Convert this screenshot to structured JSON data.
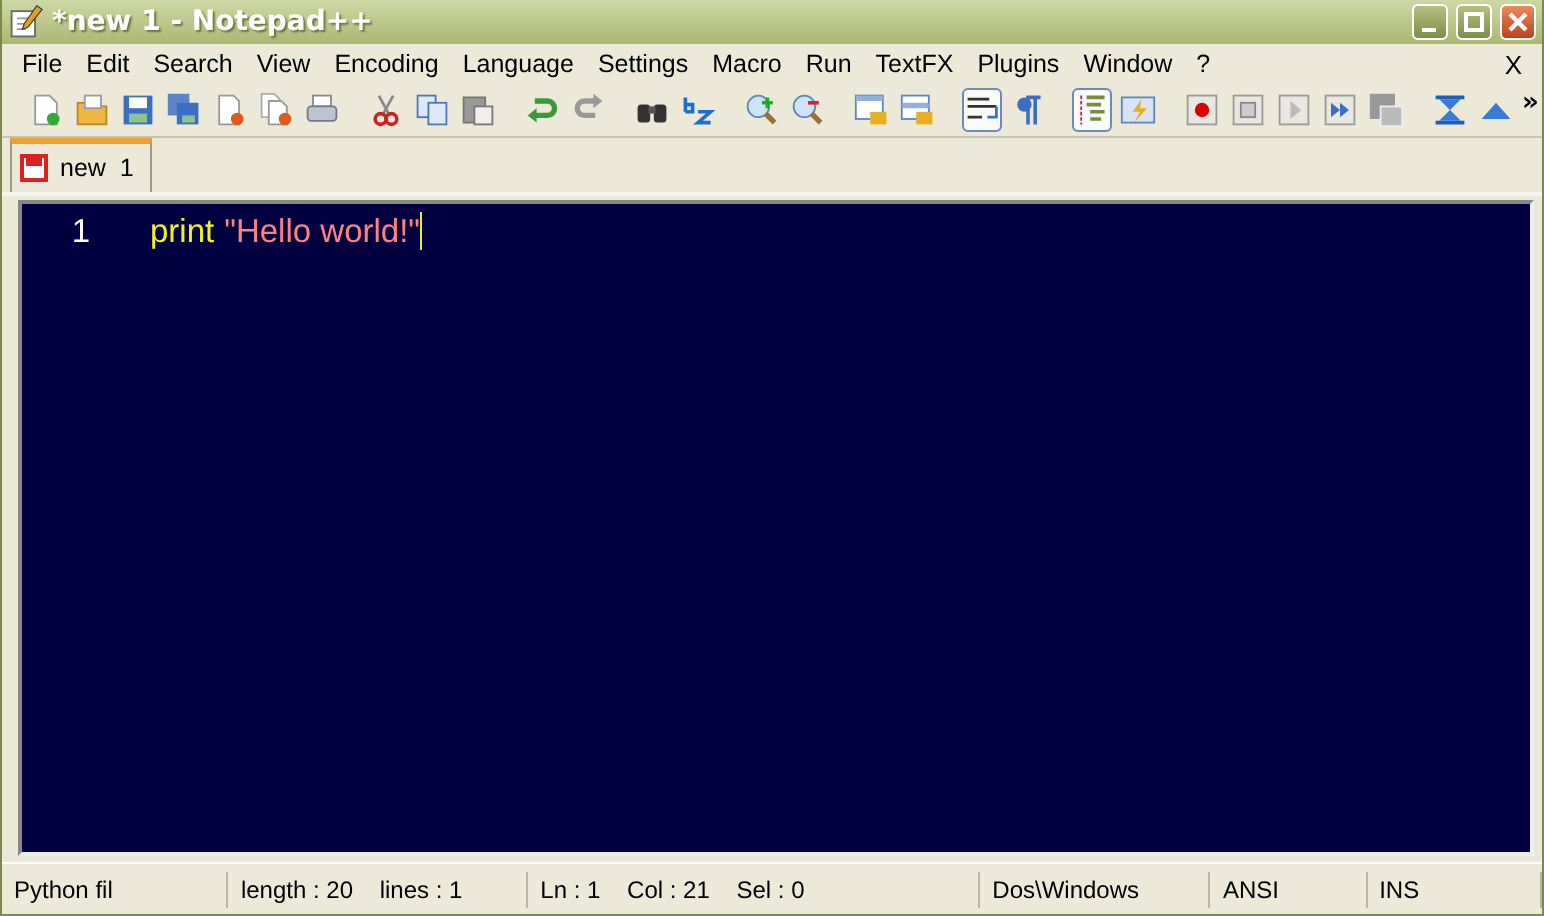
{
  "window": {
    "title": "*new  1 - Notepad++"
  },
  "menu": [
    "File",
    "Edit",
    "Search",
    "View",
    "Encoding",
    "Language",
    "Settings",
    "Macro",
    "Run",
    "TextFX",
    "Plugins",
    "Window",
    "?"
  ],
  "menu_close": "X",
  "toolbar": [
    {
      "kind": "button",
      "pressed": false
    },
    {
      "kind": "button",
      "pressed": false
    },
    {
      "kind": "button",
      "pressed": false
    },
    {
      "kind": "button",
      "pressed": false
    },
    {
      "kind": "button",
      "pressed": false
    },
    {
      "kind": "button",
      "pressed": false
    },
    {
      "kind": "button",
      "pressed": false
    },
    {
      "kind": "separator"
    },
    {
      "kind": "button",
      "pressed": false
    },
    {
      "kind": "button",
      "pressed": false
    },
    {
      "kind": "button",
      "pressed": false
    },
    {
      "kind": "separator"
    },
    {
      "kind": "button",
      "pressed": false
    },
    {
      "kind": "button",
      "pressed": false
    },
    {
      "kind": "separator"
    },
    {
      "kind": "button",
      "pressed": false
    },
    {
      "kind": "button",
      "pressed": false
    },
    {
      "kind": "separator"
    },
    {
      "kind": "button",
      "pressed": false
    },
    {
      "kind": "button",
      "pressed": false
    },
    {
      "kind": "separator"
    },
    {
      "kind": "button",
      "pressed": false
    },
    {
      "kind": "button",
      "pressed": false
    },
    {
      "kind": "separator"
    },
    {
      "kind": "button",
      "pressed": true
    },
    {
      "kind": "button",
      "pressed": false
    },
    {
      "kind": "separator"
    },
    {
      "kind": "button",
      "pressed": true
    },
    {
      "kind": "button",
      "pressed": false
    },
    {
      "kind": "separator"
    },
    {
      "kind": "button",
      "pressed": false
    },
    {
      "kind": "button",
      "pressed": false
    },
    {
      "kind": "button",
      "pressed": false
    },
    {
      "kind": "button",
      "pressed": false
    },
    {
      "kind": "button",
      "pressed": false
    },
    {
      "kind": "separator"
    },
    {
      "kind": "button",
      "pressed": false
    },
    {
      "kind": "button",
      "pressed": false
    }
  ],
  "toolbar_overflow": "»",
  "tabs": [
    {
      "label": "new  1",
      "selected": true,
      "modified": true
    }
  ],
  "editor": {
    "lines": [
      {
        "number": "1",
        "tokens": [
          {
            "kind": "keyword",
            "text": "print"
          },
          {
            "kind": "string",
            "text": "\"Hello world!\""
          }
        ]
      }
    ]
  },
  "status_bar": [
    "Python fil",
    "length : 20    lines : 1",
    "Ln : 1    Col : 21    Sel : 0",
    "Dos\\Windows",
    "ANSI",
    "INS"
  ]
}
